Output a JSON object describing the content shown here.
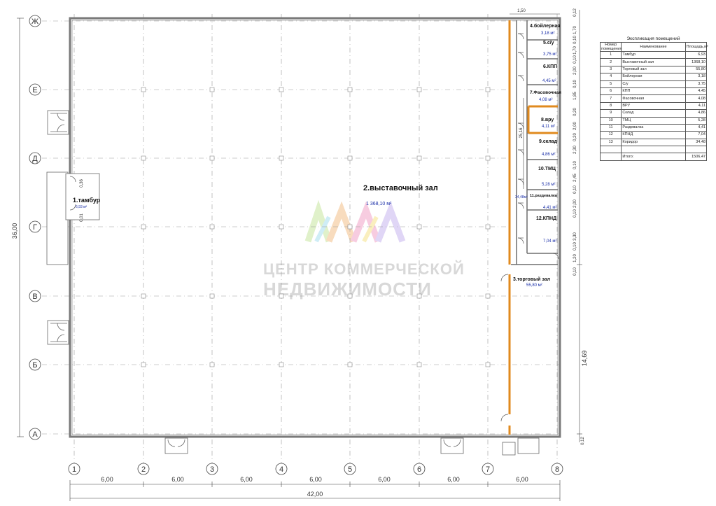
{
  "axes": {
    "rows": [
      "Ж",
      "Е",
      "Д",
      "Г",
      "В",
      "Б",
      "А"
    ],
    "columns": [
      "1",
      "2",
      "3",
      "4",
      "5",
      "6",
      "7",
      "8"
    ]
  },
  "dimensions": {
    "bays": [
      "6,00",
      "6,00",
      "6,00",
      "6,00",
      "6,00",
      "6,00",
      "6,00"
    ],
    "total_width": "42,00",
    "total_height": "36,00",
    "right_lower": "14,69",
    "corridor_width": "1,50",
    "corridor_height": "25,16",
    "top_right": "0,12",
    "bottom_right": "0,12",
    "right_offsets": [
      "1,70",
      "0,10",
      "1,70",
      "0,10",
      "2,00",
      "0,10",
      "1,85",
      "0,20",
      "2,00",
      "0,20",
      "2,30",
      "0,10",
      "2,45",
      "0,10",
      "2,00",
      "0,10",
      "3,30",
      "0,10",
      "1,20",
      "0,10"
    ],
    "tambur_dims": [
      "0,36",
      "0,01"
    ]
  },
  "rooms": {
    "r1": {
      "name": "1.тамбур",
      "area": "6,93 м²"
    },
    "r2": {
      "name": "2.выставочный зал",
      "area": "1 368,10 м²"
    },
    "r3": {
      "name": "3.торговый зал",
      "area": "55,80 м²"
    },
    "r4": {
      "name": "4.бойлерная",
      "area": "3,18 м²"
    },
    "r5": {
      "name": "5.с/у",
      "area": "3,75 м²"
    },
    "r6": {
      "name": "6.КПП",
      "area": "4,45 м²"
    },
    "r7": {
      "name": "7.Фасовочная",
      "area": "4,08 м²"
    },
    "r8": {
      "name": "8.вру",
      "area": "4,11 м²"
    },
    "r9": {
      "name": "9.склад",
      "area": "4,86 м²"
    },
    "r10": {
      "name": "10.ТМЦ",
      "area": "5,28 м²"
    },
    "r11": {
      "name": "11.раздевалка",
      "area": "4,41 м²"
    },
    "r12": {
      "name": "12.КПНД",
      "area": "7,04 м²"
    },
    "corridor_area": "34,48м²"
  },
  "watermark": {
    "line1": "ЦЕНТР КОММЕРЧЕСКОЙ",
    "line2": "НЕДВИЖИМОСТИ"
  },
  "legend": {
    "title": "Экспликация помещений",
    "headers": [
      "Номер помещения",
      "Наименование",
      "Площадь,м²"
    ],
    "rows": [
      [
        "1",
        "Тамбур",
        "6,93"
      ],
      [
        "2",
        "Выставочный зал",
        "1368,10"
      ],
      [
        "3",
        "Торговый зал",
        "55,80"
      ],
      [
        "4",
        "Бойлерная",
        "3,18"
      ],
      [
        "5",
        "С/у",
        "3,75"
      ],
      [
        "6",
        "КПП",
        "4,45"
      ],
      [
        "7",
        "Фасовочная",
        "4,08"
      ],
      [
        "8",
        "ВРУ",
        "4,11"
      ],
      [
        "9",
        "Склад",
        "4,86"
      ],
      [
        "10",
        "ТМЦ",
        "5,28"
      ],
      [
        "11",
        "Раздевалка",
        "4,41"
      ],
      [
        "12",
        "КПНД",
        "7,04"
      ],
      [
        "13",
        "Коридор",
        "34,48"
      ],
      [
        "",
        "",
        ""
      ],
      [
        "",
        "Итого:",
        "1506,47"
      ]
    ]
  },
  "colors": {
    "wall": "#7a7a7a",
    "accent_wall": "#e08a1e",
    "grid": "#9a9a9a",
    "area_text": "#1a2fa8"
  }
}
